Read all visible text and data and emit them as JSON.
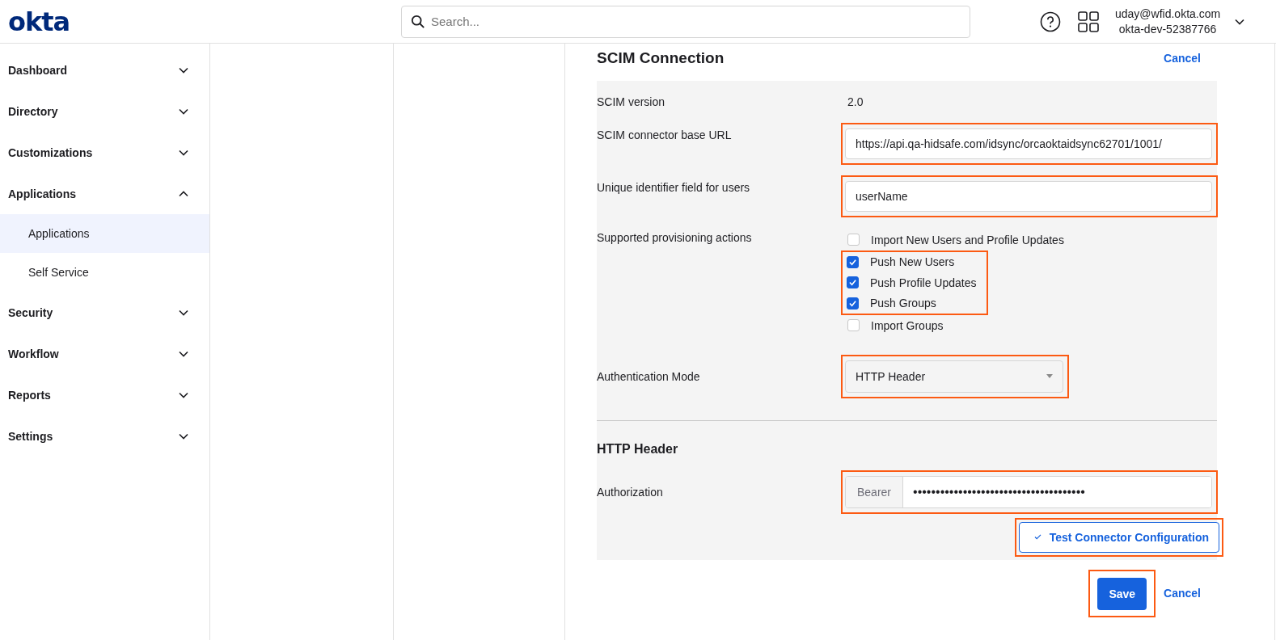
{
  "header": {
    "logo": "okta",
    "search": {
      "placeholder": "Search..."
    },
    "user": {
      "email": "uday@wfid.okta.com",
      "org": "okta-dev-52387766"
    }
  },
  "sidebar": {
    "items": [
      {
        "label": "Dashboard",
        "expanded": false
      },
      {
        "label": "Directory",
        "expanded": false
      },
      {
        "label": "Customizations",
        "expanded": false
      },
      {
        "label": "Applications",
        "expanded": true,
        "children": [
          {
            "label": "Applications",
            "selected": true
          },
          {
            "label": "Self Service",
            "selected": false
          }
        ]
      },
      {
        "label": "Security",
        "expanded": false
      },
      {
        "label": "Workflow",
        "expanded": false
      },
      {
        "label": "Reports",
        "expanded": false
      },
      {
        "label": "Settings",
        "expanded": false
      }
    ]
  },
  "section": {
    "title": "SCIM Connection",
    "cancel_link": "Cancel"
  },
  "form": {
    "rows": [
      {
        "kind": "text",
        "label": "SCIM version",
        "value": "2.0"
      },
      {
        "kind": "input",
        "label": "SCIM connector base URL",
        "value": "https://api.qa-hidsafe.com/idsync/orcaoktaidsync62701/1001/",
        "highlighted": true
      },
      {
        "kind": "input",
        "label": "Unique identifier field for users",
        "value": "userName",
        "highlighted": true
      },
      {
        "kind": "checks",
        "label": "Supported provisioning actions",
        "options": [
          {
            "label": "Import New Users and Profile Updates",
            "checked": false,
            "highlighted": false
          },
          {
            "label": "Push New Users",
            "checked": true,
            "highlighted": true
          },
          {
            "label": "Push Profile Updates",
            "checked": true,
            "highlighted": true
          },
          {
            "label": "Push Groups",
            "checked": true,
            "highlighted": true
          },
          {
            "label": "Import Groups",
            "checked": false,
            "highlighted": false
          }
        ]
      },
      {
        "kind": "select",
        "label": "Authentication Mode",
        "value": "HTTP Header",
        "highlighted": true
      }
    ],
    "subheading": "HTTP Header",
    "auth": {
      "label": "Authorization",
      "prefix": "Bearer",
      "value": "••••••••••••••••••••••••••••••••••••••",
      "highlighted": true
    },
    "test_button": {
      "label": "Test Connector Configuration",
      "highlighted": true
    }
  },
  "footer": {
    "save": {
      "label": "Save",
      "highlighted": true
    },
    "cancel": "Cancel"
  }
}
